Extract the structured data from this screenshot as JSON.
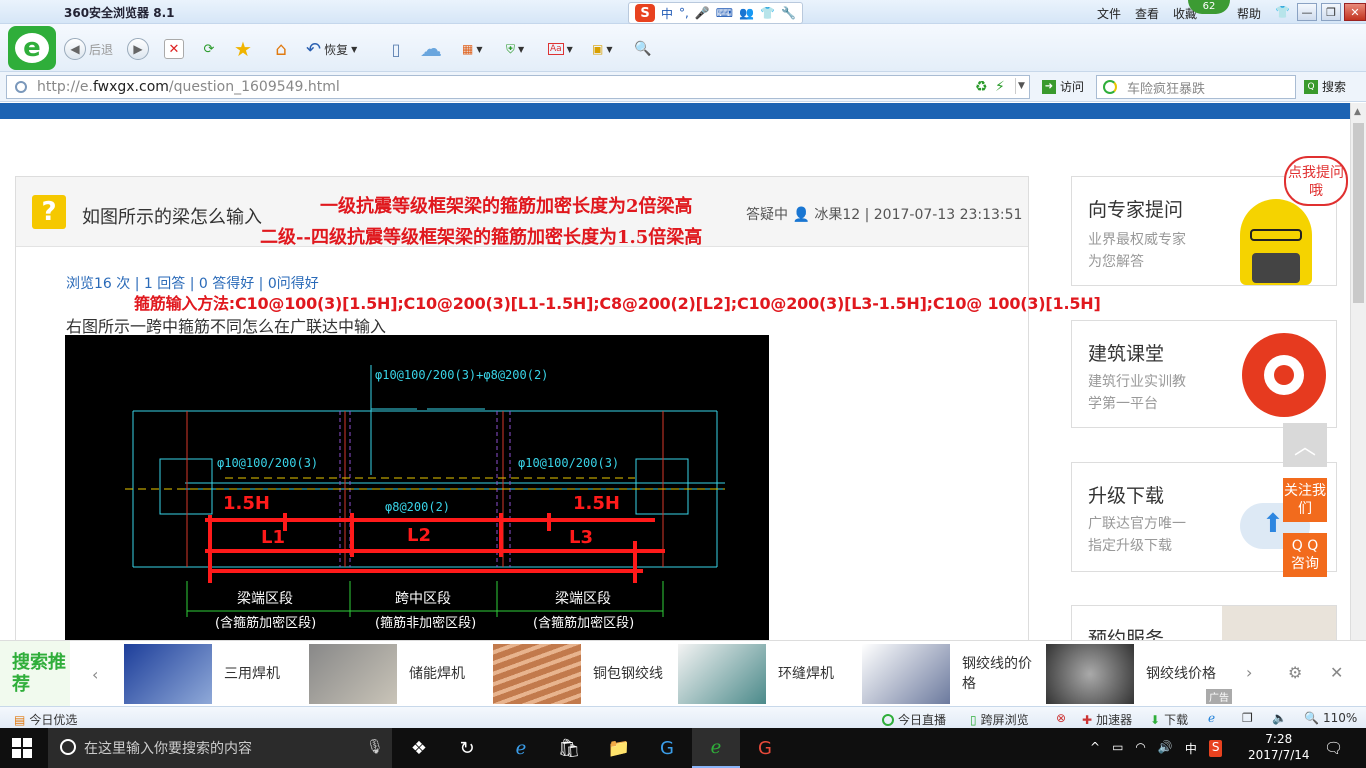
{
  "window": {
    "title": "360安全浏览器 8.1",
    "menu": [
      "文件",
      "查看",
      "收藏",
      "帮助"
    ],
    "badge": "62"
  },
  "ime": {
    "chars": [
      "中",
      "°,"
    ]
  },
  "toolbar": {
    "back": "后退",
    "restore": "恢复"
  },
  "address": {
    "prefix": "http://e.",
    "host": "fwxgx.com",
    "path": "/question_1609549.html",
    "visit": "访问",
    "search_placeholder": "车险疯狂暴跌",
    "search_button": "搜索"
  },
  "question": {
    "title": "如图所示的梁怎么输入",
    "meta": "冰果12 | 2017-07-13 23:13:51",
    "meta_hidden": "答疑中",
    "stats": "浏览16 次 | 1 回答 | 0 答得好 | 0问得好",
    "description": "右图所示一跨中箍筋不同怎么在广联达中输入"
  },
  "annotations": {
    "line1": "一级抗震等级框架梁的箍筋加密长度为2倍梁高",
    "line2": "二级--四级抗震等级框架梁的箍筋加密长度为1.5倍梁高",
    "line3": "箍筋输入方法:C10@100(3)[1.5H];C10@200(3)[L1-1.5H];C8@200(2)[L2];C10@200(3)[L3-1.5H];C10@ 100(3)[1.5H]"
  },
  "cad": {
    "top_label": "φ10@100/200(3)+φ8@200(2)",
    "left_label": "φ10@100/200(3)",
    "right_label": "φ10@100/200(3)",
    "mid_label": "φ8@200(2)",
    "h_left": "1.5H",
    "h_right": "1.5H",
    "l1": "L1",
    "l2": "L2",
    "l3": "L3",
    "zone_left": "梁端区段",
    "zone_left_sub": "(含箍筋加密区段)",
    "zone_mid": "跨中区段",
    "zone_mid_sub": "(箍筋非加密区段)",
    "zone_right": "梁端区段",
    "zone_right_sub": "(含箍筋加密区段)"
  },
  "sidebar": {
    "expert_title": "向专家提问",
    "expert_desc1": "业界最权威专家",
    "expert_desc2": "为您解答",
    "bubble": "点我提问哦",
    "class_title": "建筑课堂",
    "class_desc1": "建筑行业实训教",
    "class_desc2": "学第一平台",
    "upgrade_title": "升级下载",
    "upgrade_desc1": "广联达官方唯一",
    "upgrade_desc2": "指定升级下载",
    "booking_title": "预约服务",
    "follow": "关注我们",
    "qq": "Q Q 咨询"
  },
  "recommend": {
    "label": "搜索推荐",
    "items": [
      "三用焊机",
      "储能焊机",
      "铜包钢绞线",
      "环缝焊机",
      "钢绞线的价格",
      "钢绞线价格"
    ],
    "ad": "广告"
  },
  "status": {
    "left": "今日优选",
    "live": "今日直播",
    "cross": "跨屏浏览",
    "accel": "加速器",
    "download": "下载",
    "zoom": "110%"
  },
  "taskbar": {
    "search_placeholder": "在这里输入你要搜索的内容",
    "ime": "中",
    "time": "7:28",
    "date": "2017/7/14"
  },
  "colors": {
    "brand_green": "#2fae3a",
    "page_blue": "#1c63b3",
    "annotation_red": "#e0181e",
    "accent_orange": "#f26b1d"
  }
}
